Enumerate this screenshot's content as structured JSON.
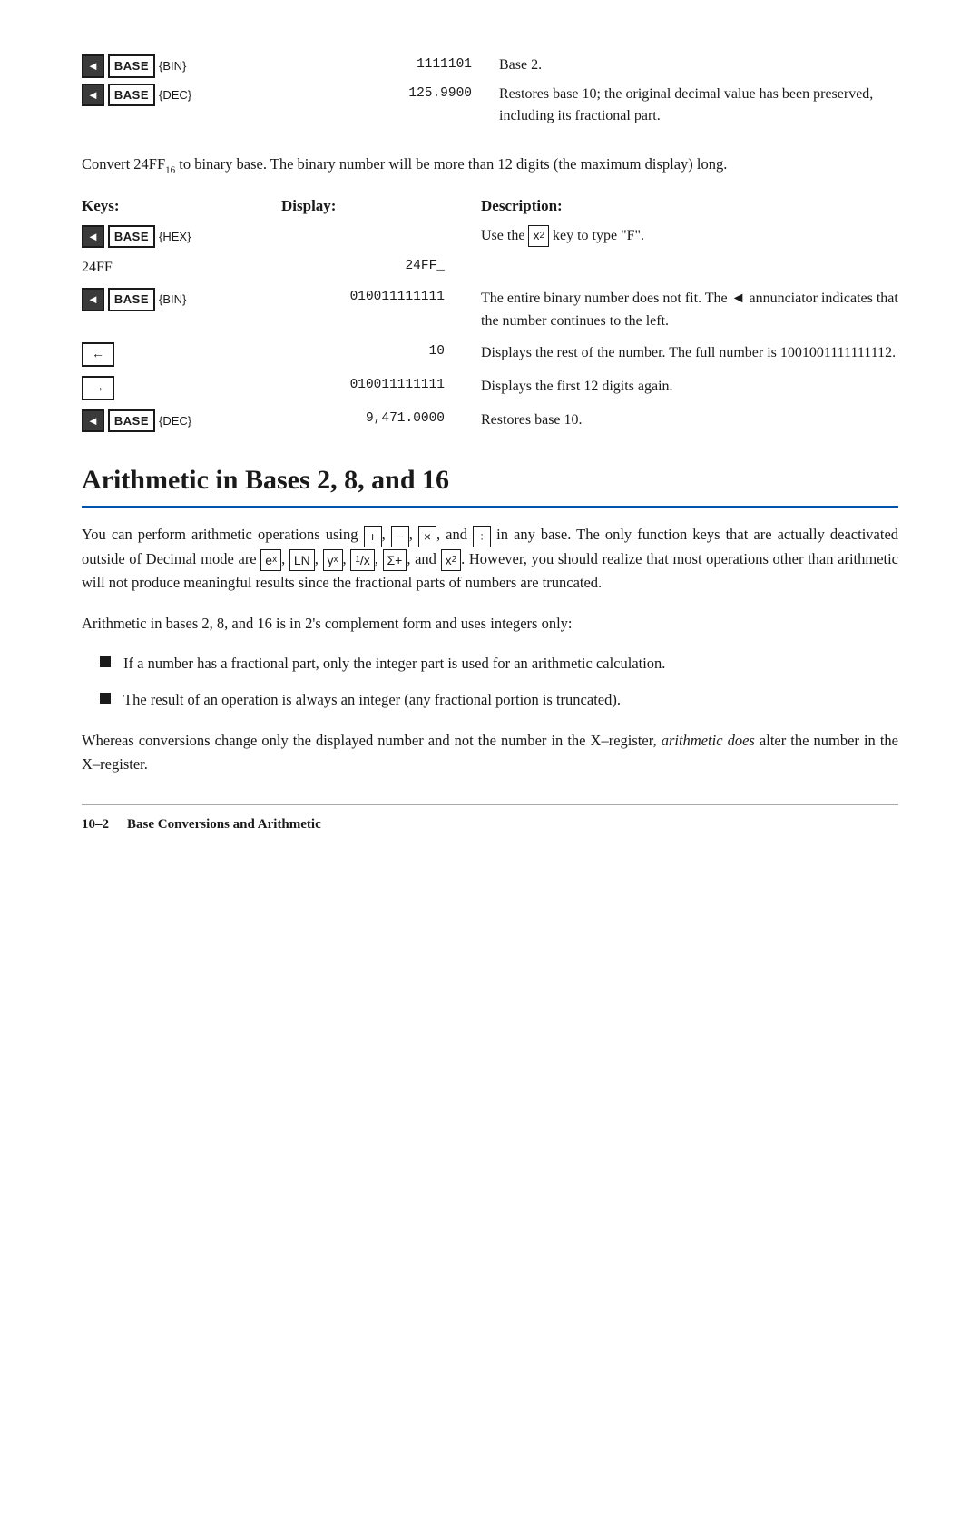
{
  "top_table": {
    "rows": [
      {
        "keys_label": "BASE {BIN}",
        "display": "1111101",
        "desc": "Base 2."
      },
      {
        "keys_label": "BASE {DEC}",
        "display": "125.9900",
        "desc": "Restores base 10; the original decimal value has been preserved, including its fractional part."
      }
    ]
  },
  "convert_para": "Convert 24FF",
  "convert_subscript": "16",
  "convert_para2": " to binary base. The binary number will be more than 12 digits (the maximum display) long.",
  "main_table": {
    "headers": {
      "keys": "Keys:",
      "display": "Display:",
      "desc": "Description:"
    },
    "rows": [
      {
        "keys1": "BASE {HEX}",
        "keys2": "",
        "display1": "",
        "display2": "",
        "desc": "Use the  key to type \"F\".",
        "desc_key": "x²"
      },
      {
        "keys1": "24FF",
        "keys2": "",
        "display1": "24FF_",
        "display2": "",
        "desc": ""
      },
      {
        "keys1": "BASE {BIN}",
        "keys2": "",
        "display1": "010011111111",
        "display2": "",
        "desc": "The entire binary number does not fit. The ◄ annunciator indicates that the number continues to the left."
      },
      {
        "keys1": "←",
        "keys2": "",
        "display1": "10",
        "display2": "",
        "desc": "Displays the rest of the number. The full number is 1001001111111112."
      },
      {
        "keys1": "→",
        "keys2": "",
        "display1": "010011111111",
        "display2": "",
        "desc": "Displays the first 12 digits again."
      },
      {
        "keys1": "BASE {DEC}",
        "keys2": "",
        "display1": "9,471.0000",
        "display2": "",
        "desc": "Restores base 10."
      }
    ]
  },
  "section_heading": "Arithmetic in Bases 2, 8, and 16",
  "para1": "You can perform arithmetic operations using",
  "para1_keys": [
    "+",
    "−",
    "×",
    "÷"
  ],
  "para1_end": "in any base. The only function keys that are actually deactivated outside of Decimal mode are",
  "para1_keys2": [
    "eˣ",
    "LN",
    "yˣ",
    "1/x",
    "Σ+",
    "x²"
  ],
  "para1_end2": ". However, you should realize that most operations other than arithmetic will not produce meaningful results since the fractional parts of numbers are truncated.",
  "para2": "Arithmetic in bases 2, 8, and 16 is in 2's complement form and uses integers only:",
  "bullets": [
    "If a number has a fractional part, only the integer part is used for an arithmetic calculation.",
    "The result of an operation is always an integer (any fractional portion is truncated)."
  ],
  "para3_start": "Whereas conversions change only the displayed number and not the number in the X–register,",
  "para3_italic": "arithmetic does",
  "para3_end": "alter the number in the X–register.",
  "footer": {
    "label": "10–2",
    "title": "Base Conversions and Arithmetic"
  }
}
